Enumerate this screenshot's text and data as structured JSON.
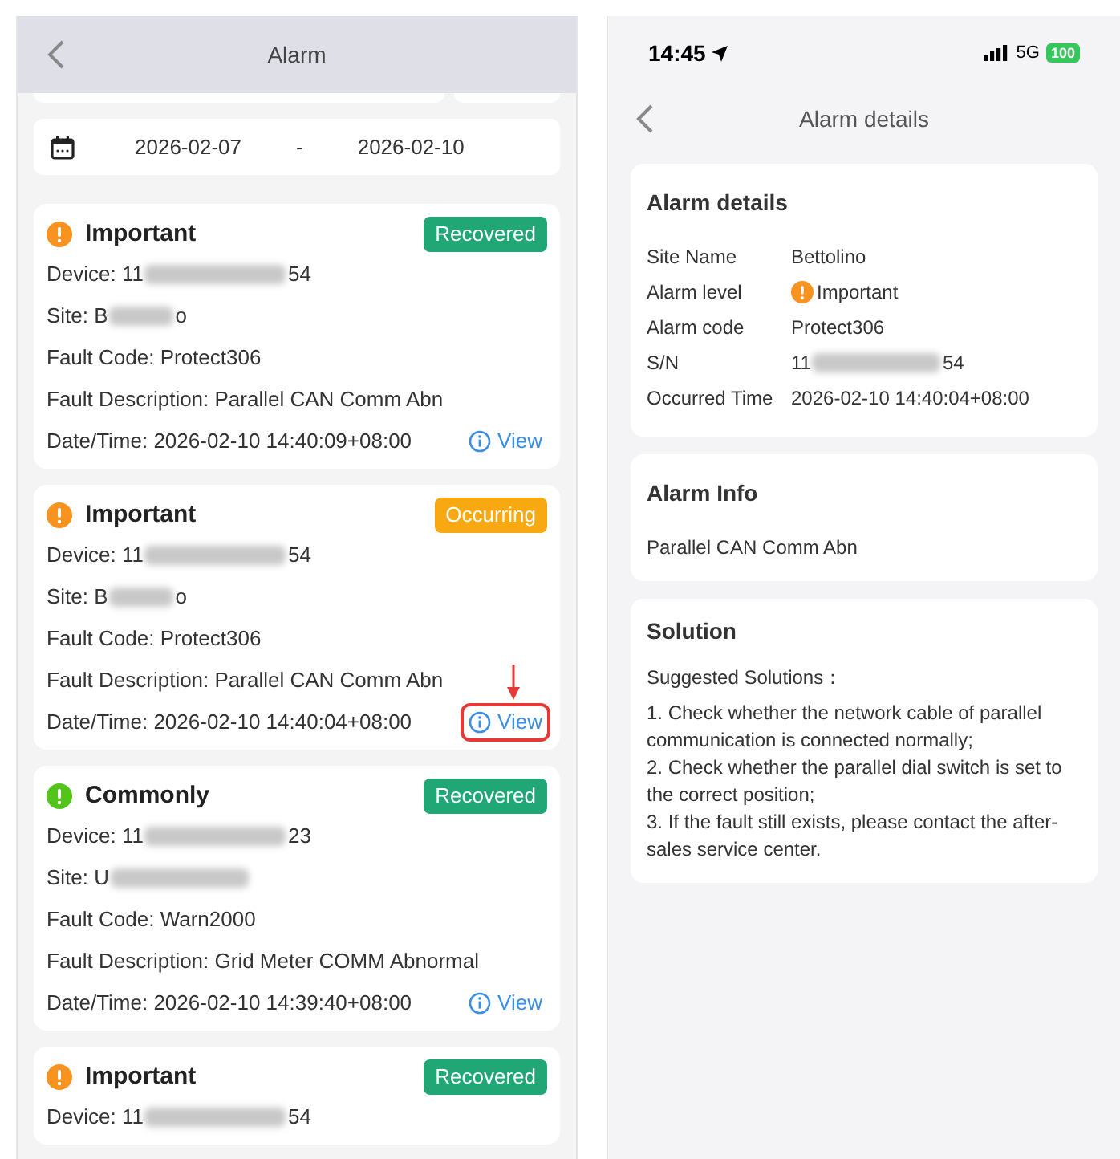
{
  "left": {
    "nav": {
      "title": "Alarm"
    },
    "date_range": {
      "start": "2026-02-07",
      "separator": "-",
      "end": "2026-02-10"
    },
    "alarms": [
      {
        "color": "#f7931e",
        "level": "Important",
        "status": {
          "label": "Recovered",
          "color": "#21a675"
        },
        "device": {
          "prefix": "Device: 11",
          "suffix": "54"
        },
        "site": {
          "prefix": "Site: B",
          "suffix": "o"
        },
        "fault_code": "Fault Code: Protect306",
        "fault_description": "Fault Description: Parallel CAN Comm Abn",
        "datetime": "Date/Time: 2026-02-10 14:40:09+08:00",
        "view": "View",
        "highlighted": false
      },
      {
        "color": "#f7931e",
        "level": "Important",
        "status": {
          "label": "Occurring",
          "color": "#f8a811"
        },
        "device": {
          "prefix": "Device: 11",
          "suffix": "54"
        },
        "site": {
          "prefix": "Site: B",
          "suffix": "o"
        },
        "fault_code": "Fault Code: Protect306",
        "fault_description": "Fault Description: Parallel CAN Comm Abn",
        "datetime": "Date/Time: 2026-02-10 14:40:04+08:00",
        "view": "View",
        "highlighted": true
      },
      {
        "color": "#52c41a",
        "level": "Commonly",
        "status": {
          "label": "Recovered",
          "color": "#21a675"
        },
        "device": {
          "prefix": "Device: 11",
          "suffix": "23"
        },
        "site": {
          "prefix": "Site: U"
        },
        "fault_code": "Fault Code: Warn2000",
        "fault_description": "Fault Description: Grid Meter COMM Abnormal",
        "datetime": "Date/Time: 2026-02-10 14:39:40+08:00",
        "view": "View",
        "highlighted": false
      },
      {
        "color": "#f7931e",
        "level": "Important",
        "status": {
          "label": "Recovered",
          "color": "#21a675"
        },
        "device": {
          "prefix": "Device: 11",
          "suffix": "54"
        }
      }
    ]
  },
  "right": {
    "status_bar": {
      "time": "14:45",
      "network": "5G",
      "battery": "100"
    },
    "nav": {
      "title": "Alarm details"
    },
    "details": {
      "title": "Alarm details",
      "rows": [
        {
          "kind": "text",
          "label": "Site Name",
          "value": "Bettolino"
        },
        {
          "kind": "level",
          "label": "Alarm level",
          "value": "Important",
          "color": "#f7931e"
        },
        {
          "kind": "text",
          "label": "Alarm code",
          "value": "Protect306"
        },
        {
          "kind": "masked",
          "label": "S/N",
          "prefix": "11",
          "suffix": "54"
        },
        {
          "kind": "text",
          "label": "Occurred Time",
          "value": "2026-02-10 14:40:04+08:00"
        }
      ]
    },
    "info": {
      "title": "Alarm Info",
      "text": "Parallel CAN Comm Abn"
    },
    "solution": {
      "title": "Solution",
      "intro": "Suggested Solutions：",
      "steps": [
        "1. Check whether the network cable of parallel communication is connected normally;",
        "2. Check whether the parallel dial switch is set to the correct position;",
        "3. If the fault still exists, please contact the after-sales service center."
      ]
    }
  }
}
